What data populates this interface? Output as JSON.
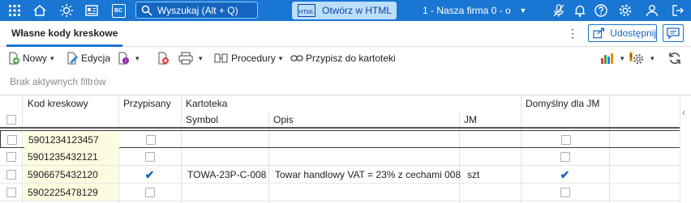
{
  "topbar": {
    "search_placeholder": "Wyszukaj (Alt + Q)",
    "html_button_label": "Otwórz w HTML",
    "html_icon_text": "HTML",
    "company": "1 - Nasza firma 0 - o",
    "bc_label": "BC"
  },
  "tab": {
    "label": "Własne kody kreskowe"
  },
  "share_label": "Udostępnij",
  "toolbar": {
    "new_label": "Nowy",
    "edit_label": "Edycja",
    "procedures_label": "Procedury",
    "assign_label": "Przypisz do kartoteki"
  },
  "filter_text": "Brak aktywnych filtrów",
  "grid": {
    "headers": {
      "code": "Kod kreskowy",
      "assigned": "Przypisany",
      "card": "Kartoteka",
      "default_unit": "Domyślny dla JM",
      "symbol": "Symbol",
      "description": "Opis",
      "unit": "JM"
    },
    "rows": [
      {
        "code": "5901234123457",
        "assigned": false,
        "symbol": "",
        "description": "",
        "unit": "",
        "default": false
      },
      {
        "code": "5901235432121",
        "assigned": false,
        "symbol": "",
        "description": "",
        "unit": "",
        "default": false
      },
      {
        "code": "5906675432120",
        "assigned": true,
        "symbol": "TOWA-23P-C-008",
        "description": "Towar handlowy VAT = 23% z cechami 008",
        "unit": "szt",
        "default": true
      },
      {
        "code": "5902225478129",
        "assigned": false,
        "symbol": "",
        "description": "",
        "unit": "",
        "default": false
      }
    ]
  },
  "colors": {
    "accent": "#1976d2",
    "code_bg": "#fdfbe0"
  }
}
